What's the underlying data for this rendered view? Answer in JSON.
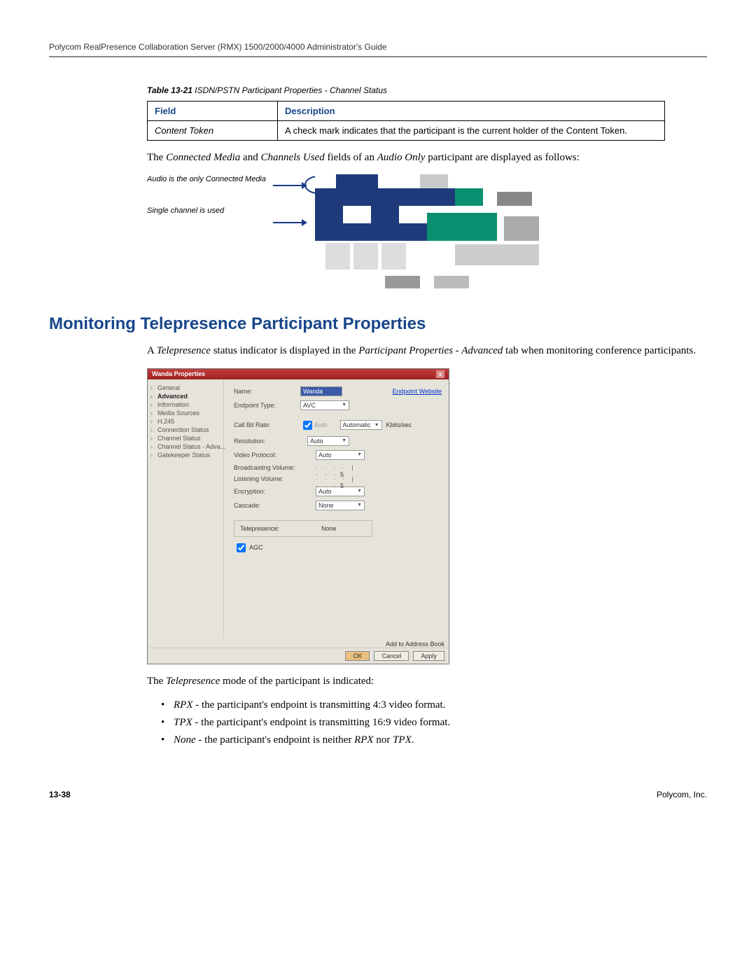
{
  "header": "Polycom RealPresence Collaboration Server (RMX) 1500/2000/4000 Administrator's Guide",
  "table": {
    "caption_prefix": "Table 13-21",
    "caption_title": "ISDN/PSTN Participant Properties - Channel Status",
    "col_field": "Field",
    "col_desc": "Description",
    "row_field": "Content Token",
    "row_desc": "A check mark indicates that the participant is the current holder of the Content Token."
  },
  "para1_pre": "The ",
  "para1_i1": "Connected Media",
  "para1_mid": " and ",
  "para1_i2": "Channels Used",
  "para1_mid2": " fields of an ",
  "para1_i3": "Audio Only",
  "para1_end": " participant are displayed as follows:",
  "callout1": "Audio is the only Connected Media",
  "callout2": "Single channel is used",
  "section_heading": "Monitoring Telepresence Participant Properties",
  "para2_pre": "A ",
  "para2_i1": "Telepresence",
  "para2_mid": " status indicator is displayed in the ",
  "para2_i2": "Participant Properties - Advanced",
  "para2_end": " tab when monitoring conference participants.",
  "dialog": {
    "title": "Wanda  Properties",
    "close": "x",
    "nav": [
      "General",
      "Advanced",
      "Information",
      "Media Sources",
      "H.245",
      "Connection Status",
      "Channel Status",
      "Channel Status - Adva...",
      "Gatekeeper Status"
    ],
    "nav_active_index": 1,
    "rows": {
      "name_lbl": "Name:",
      "name_val": "Wanda",
      "endpoint_link": "Endpoint Website",
      "ep_type_lbl": "Endpoint Type:",
      "ep_type_val": "AVC",
      "bitrate_lbl": "Call Bit Rate:",
      "bitrate_chk": "Auto",
      "bitrate_sel": "Automatic",
      "bitrate_unit": "Kbits/sec",
      "res_lbl": "Resolution:",
      "res_val": "Auto",
      "vproto_lbl": "Video Protocol:",
      "vproto_val": "Auto",
      "bvol_lbl": "Broadcasting Volume:",
      "bvol_val": "5",
      "lvol_lbl": "Listening Volume:",
      "lvol_val": "5",
      "enc_lbl": "Encryption:",
      "enc_val": "Auto",
      "casc_lbl": "Cascade:",
      "casc_val": "None",
      "tel_lbl": "Telepresence:",
      "tel_val": "None",
      "agc_lbl": "AGC"
    },
    "buttons": {
      "addr": "Add to Address Book",
      "ok": "OK",
      "cancel": "Cancel",
      "apply": "Apply"
    }
  },
  "para3_pre": "The ",
  "para3_i1": "Telepresence",
  "para3_end": " mode of the participant is indicated:",
  "modes": [
    {
      "name": "RPX",
      "text": " - the participant's endpoint is transmitting 4:3 video format."
    },
    {
      "name": "TPX",
      "text": " - the participant's endpoint is transmitting 16:9 video format."
    },
    {
      "name": "None",
      "text_pre": " - the participant's endpoint is neither ",
      "mid1": "RPX",
      "mid2": " nor ",
      "mid3": "TPX",
      "text_post": "."
    }
  ],
  "footer_left": "13-38",
  "footer_right": "Polycom, Inc."
}
